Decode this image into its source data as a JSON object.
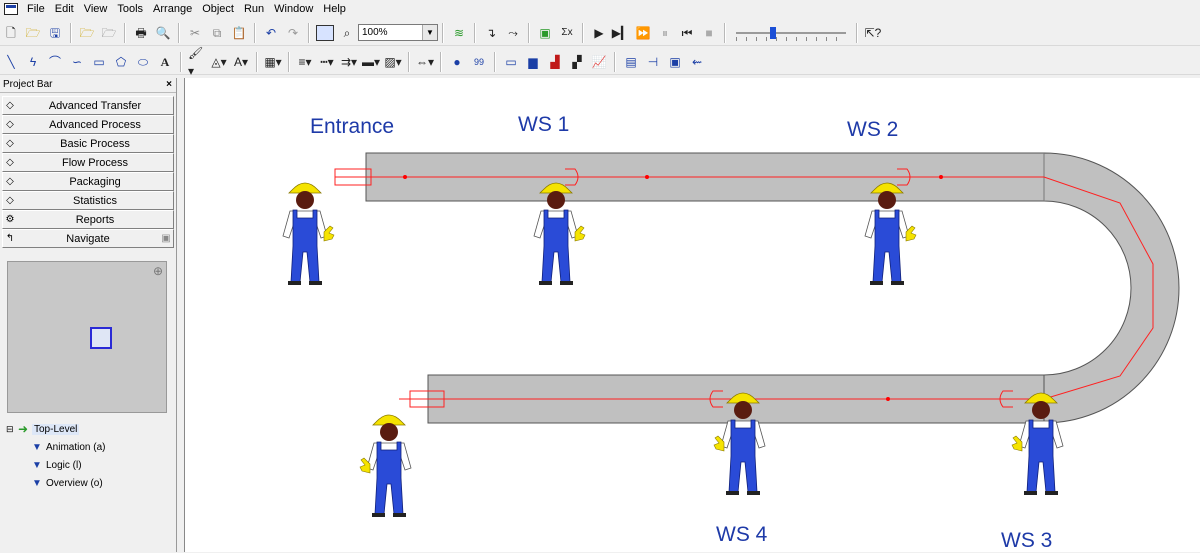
{
  "menu": [
    "File",
    "Edit",
    "View",
    "Tools",
    "Arrange",
    "Object",
    "Run",
    "Window",
    "Help"
  ],
  "toolbar": {
    "zoom": "100%"
  },
  "project_bar": {
    "title": "Project Bar",
    "close": "×",
    "panels": [
      "Advanced Transfer",
      "Advanced Process",
      "Basic Process",
      "Flow Process",
      "Packaging",
      "Statistics",
      "Reports",
      "Navigate"
    ]
  },
  "tree": {
    "root": "Top-Level",
    "children": [
      "Animation (a)",
      "Logic (l)",
      "Overview (o)"
    ]
  },
  "canvas": {
    "labels": {
      "entrance": "Entrance",
      "ws1": "WS 1",
      "ws2": "WS 2",
      "ws3": "WS 3",
      "ws4": "WS 4"
    }
  },
  "colors": {
    "conveyor": "#c0c0c0",
    "route": "#ff0000",
    "worker_suit": "#2a4bd7",
    "helmet": "#f5e300",
    "label": "#1e3aa8"
  }
}
